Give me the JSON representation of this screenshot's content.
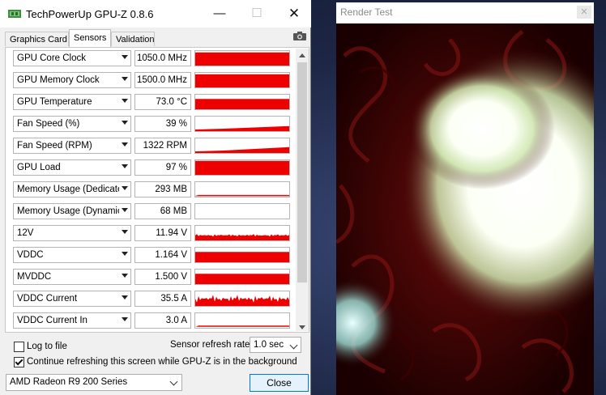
{
  "gpuz": {
    "title": "TechPowerUp GPU-Z 0.8.6",
    "tabs": [
      "Graphics Card",
      "Sensors",
      "Validation"
    ],
    "active_tab": "Sensors",
    "sensors": [
      {
        "name": "GPU Core Clock",
        "value": "1050.0 MHz",
        "level": 0.85,
        "pattern": "full"
      },
      {
        "name": "GPU Memory Clock",
        "value": "1500.0 MHz",
        "level": 0.85,
        "pattern": "full"
      },
      {
        "name": "GPU Temperature",
        "value": "73.0 °C",
        "level": 0.65,
        "pattern": "full"
      },
      {
        "name": "Fan Speed (%)",
        "value": "39 %",
        "level": 0.35,
        "pattern": "ramp"
      },
      {
        "name": "Fan Speed (RPM)",
        "value": "1322 RPM",
        "level": 0.4,
        "pattern": "ramp"
      },
      {
        "name": "GPU Load",
        "value": "97 %",
        "level": 0.9,
        "pattern": "full"
      },
      {
        "name": "Memory Usage (Dedicated)",
        "value": "293 MB",
        "level": 0.12,
        "pattern": "line"
      },
      {
        "name": "Memory Usage (Dynamic)",
        "value": "68 MB",
        "level": 0.0,
        "pattern": "none"
      },
      {
        "name": "12V",
        "value": "11.94 V",
        "level": 0.35,
        "pattern": "noisy"
      },
      {
        "name": "VDDC",
        "value": "1.164 V",
        "level": 0.65,
        "pattern": "full"
      },
      {
        "name": "MVDDC",
        "value": "1.500 V",
        "level": 0.65,
        "pattern": "full"
      },
      {
        "name": "VDDC Current",
        "value": "35.5 A",
        "level": 0.5,
        "pattern": "spiky"
      },
      {
        "name": "VDDC Current In",
        "value": "3.0 A",
        "level": 0.15,
        "pattern": "line"
      }
    ],
    "log_to_file": {
      "label": "Log to file",
      "checked": false
    },
    "continue_refresh": {
      "label": "Continue refreshing this screen while GPU-Z is in the background",
      "checked": true
    },
    "refresh_rate_label": "Sensor refresh rate:",
    "refresh_rate_value": "1.0 sec",
    "gpu_selected": "AMD Radeon R9 200 Series",
    "close_label": "Close",
    "graph_color": "#ee0000",
    "window_buttons": {
      "minimize": "—",
      "maximize": "☐",
      "close": "✕"
    }
  },
  "render_test": {
    "title": "Render Test",
    "close_glyph": "✕"
  }
}
